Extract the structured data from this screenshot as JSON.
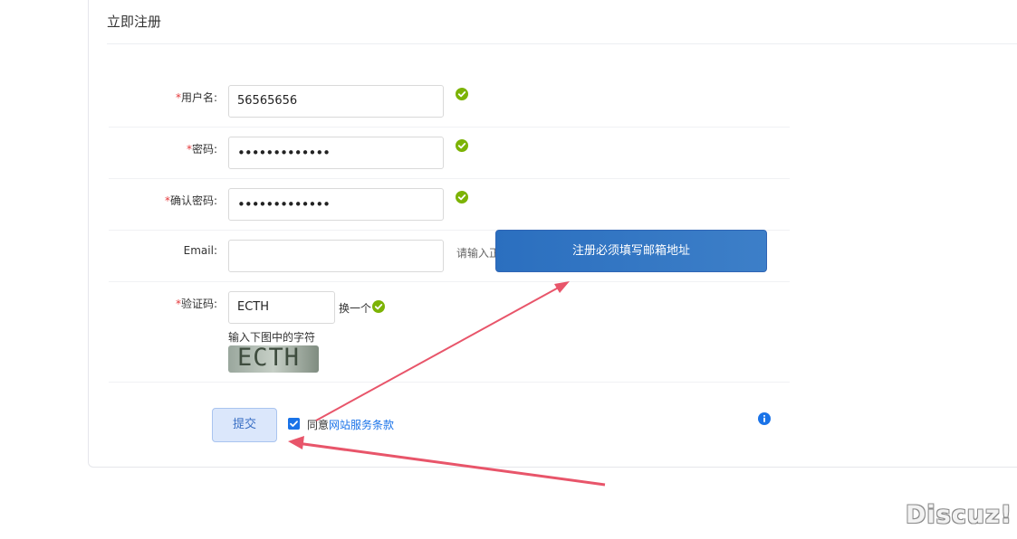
{
  "form": {
    "title": "立即注册",
    "required_mark": "*",
    "username": {
      "label": "用户名:",
      "value": "56565656"
    },
    "password": {
      "label": "密码:",
      "value": "•••••••••••••"
    },
    "confirm_password": {
      "label": "确认密码:",
      "value": "•••••••••••••"
    },
    "email": {
      "label": "Email:",
      "value": "",
      "hint": "请输入正"
    },
    "captcha": {
      "label": "验证码:",
      "value": "ECTH",
      "refresh_label": "换一个",
      "instruction": "输入下图中的字符",
      "image_text": "ECTH"
    },
    "submit_label": "提交",
    "agree_prefix": "同意",
    "agree_link": "网站服务条款",
    "agree_checked": true
  },
  "tooltip": {
    "text": "注册必须填写邮箱地址"
  },
  "watermark": {
    "text": "Discuz!"
  },
  "colors": {
    "success": "#7cb305",
    "required": "#e4393c",
    "link": "#1a73e8",
    "tooltip_bg": "#3474c4",
    "arrow": "#e8556a"
  },
  "icons": {
    "valid": "check-circle-icon",
    "info": "info-circle-icon",
    "checkbox": "checkbox-checked-icon"
  }
}
